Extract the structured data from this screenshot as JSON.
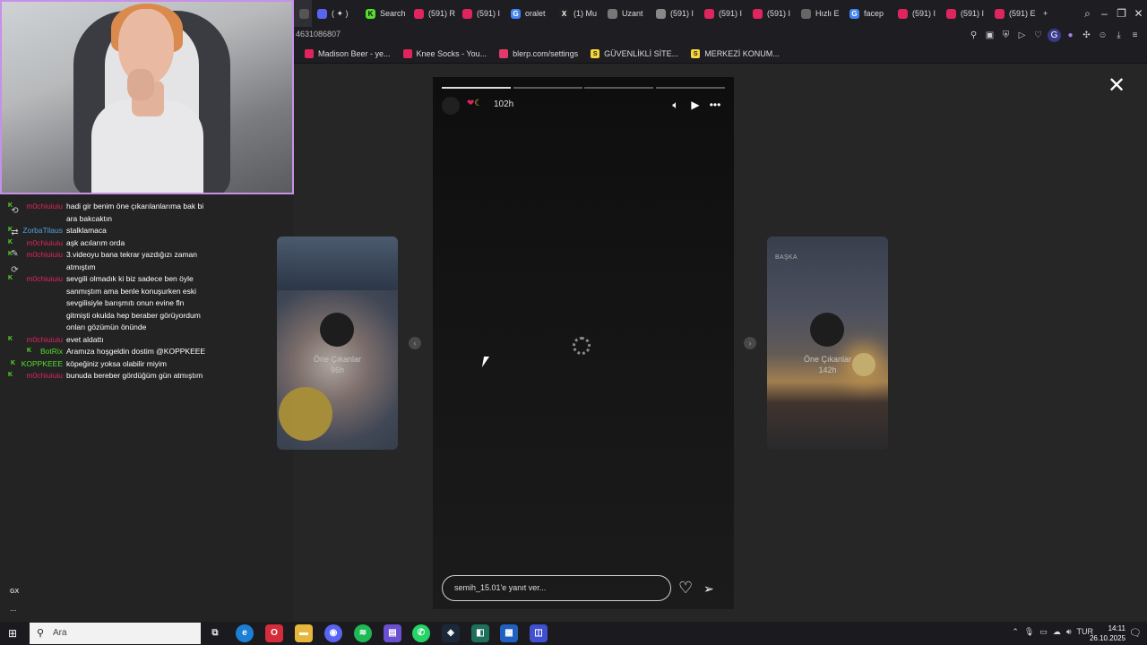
{
  "browser": {
    "tabs": [
      {
        "label": "",
        "icon": "stream-icon",
        "active": true
      },
      {
        "label": "( ✦ )",
        "icon": "discord-icon"
      },
      {
        "label": "Search",
        "icon": "kick-icon"
      },
      {
        "label": "(591) R",
        "icon": "youtube-icon"
      },
      {
        "label": "(591) I",
        "icon": "youtube-icon"
      },
      {
        "label": "oralet",
        "icon": "google-icon"
      },
      {
        "label": "(1) Mu",
        "icon": "x-icon"
      },
      {
        "label": "Uzant",
        "icon": "puzzle-icon"
      },
      {
        "label": "(591) I",
        "icon": "doc-icon"
      },
      {
        "label": "(591) I",
        "icon": "youtube-icon"
      },
      {
        "label": "(591) I",
        "icon": "youtube-icon"
      },
      {
        "label": "Hızlı E",
        "icon": "grid-icon"
      },
      {
        "label": "facep",
        "icon": "google-icon"
      },
      {
        "label": "(591) I",
        "icon": "youtube-icon"
      },
      {
        "label": "(591) I",
        "icon": "youtube-icon"
      },
      {
        "label": "(591) E",
        "icon": "youtube-icon"
      }
    ],
    "new_tab": "+",
    "address_fragment": "4631086807",
    "bookmarks": [
      {
        "label": "Madison Beer - ye...",
        "color": "#e0245e"
      },
      {
        "label": "Knee Socks - You...",
        "color": "#e0245e"
      },
      {
        "label": "blerp.com/settings",
        "color": "#e23b6b"
      },
      {
        "label": "GÜVENLİKLİ SİTE...",
        "color": "#f5d63a",
        "glyph": "S"
      },
      {
        "label": "MERKEZİ KONUM...",
        "color": "#f5d63a",
        "glyph": "S"
      }
    ]
  },
  "chat": {
    "messages": [
      {
        "user": "m0chiuiuiu",
        "user_color": "#e0245e",
        "lines": [
          "hadi gir benim öne çıkarılanlarıma bak bi",
          "ara bakcaktın"
        ],
        "badge": "k"
      },
      {
        "user": "ZorbaTilaus",
        "user_color": "#52a0e0",
        "lines": [
          "stalklamaca"
        ],
        "badge": "k"
      },
      {
        "user": "m0chiuiuiu",
        "user_color": "#e0245e",
        "lines": [
          "aşk acılarım orda"
        ],
        "badge": "k"
      },
      {
        "user": "m0chiuiuiu",
        "user_color": "#e0245e",
        "lines": [
          "3.videoyu bana tekrar yazdığızı zaman",
          "atmıştım"
        ],
        "badge": "k"
      },
      {
        "user": "m0chiuiuiu",
        "user_color": "#e0245e",
        "lines": [
          "sevgili olmadık ki biz sadece ben öyle",
          "sanmıştım ama benle konuşurken eski",
          "sevgilisiyle barışmıtı onun evine fln",
          "gitmişti okulda hep beraber görüyordum",
          "onları gözümün önünde"
        ],
        "badge": "k"
      },
      {
        "user": "m0chiuiuiu",
        "user_color": "#e0245e",
        "lines": [
          "evet aldattı"
        ],
        "badge": "k"
      },
      {
        "user": "BotRix",
        "user_color": "#52e02a",
        "lines": [
          "Aramıza hoşgeldin dostim @KOPPKEEE"
        ],
        "badge": "k"
      },
      {
        "user": "KOPPKEEE",
        "user_color": "#52e02a",
        "lines": [
          "köpeğiniz yoksa olabilir miyim"
        ],
        "badge": "k"
      },
      {
        "user": "m0chiuiuiu",
        "user_color": "#e0245e",
        "lines": [
          "bunuda bereber gördüğüm gün atmıştım"
        ],
        "badge": "k"
      }
    ],
    "edge_label": "GX",
    "edge_more": "..."
  },
  "story": {
    "time": "102h",
    "reply_placeholder": "semih_15.01'e yanıt ver...",
    "progress_segments": 4,
    "progress_active": 1
  },
  "prev_story": {
    "label": "Öne Çıkanlar",
    "time": "96h"
  },
  "next_story": {
    "tag": "BAŞKA",
    "label": "Öne Çıkanlar",
    "time": "142h"
  },
  "taskbar": {
    "search_placeholder": "Ara",
    "tray_lang": "TUR",
    "time": "14:11",
    "date": "26.10.2025"
  }
}
